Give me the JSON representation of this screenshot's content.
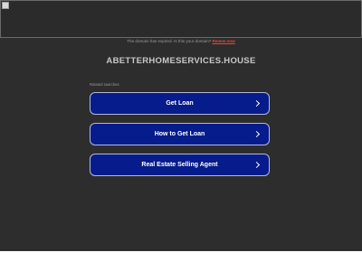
{
  "banner": {
    "icon": "broken-image-icon"
  },
  "notice": {
    "text": "The domain has expired. Is this your domain? ",
    "renew_link": "Renew now"
  },
  "domain": {
    "name": "ABETTERHOMESERVICES.HOUSE"
  },
  "related": {
    "heading": "Related searches",
    "items": [
      {
        "label": "Get Loan",
        "icon": "chevron-right-icon"
      },
      {
        "label": "How to Get Loan",
        "icon": "chevron-right-icon"
      },
      {
        "label": "Real Estate Selling Agent",
        "icon": "chevron-right-icon"
      }
    ]
  },
  "colors": {
    "page_background": "#2d2d2d",
    "button_background": "#061c8c",
    "button_border": "#b5b8d6",
    "renew_link": "#e0483b",
    "domain_text": "#c8c8c8"
  }
}
